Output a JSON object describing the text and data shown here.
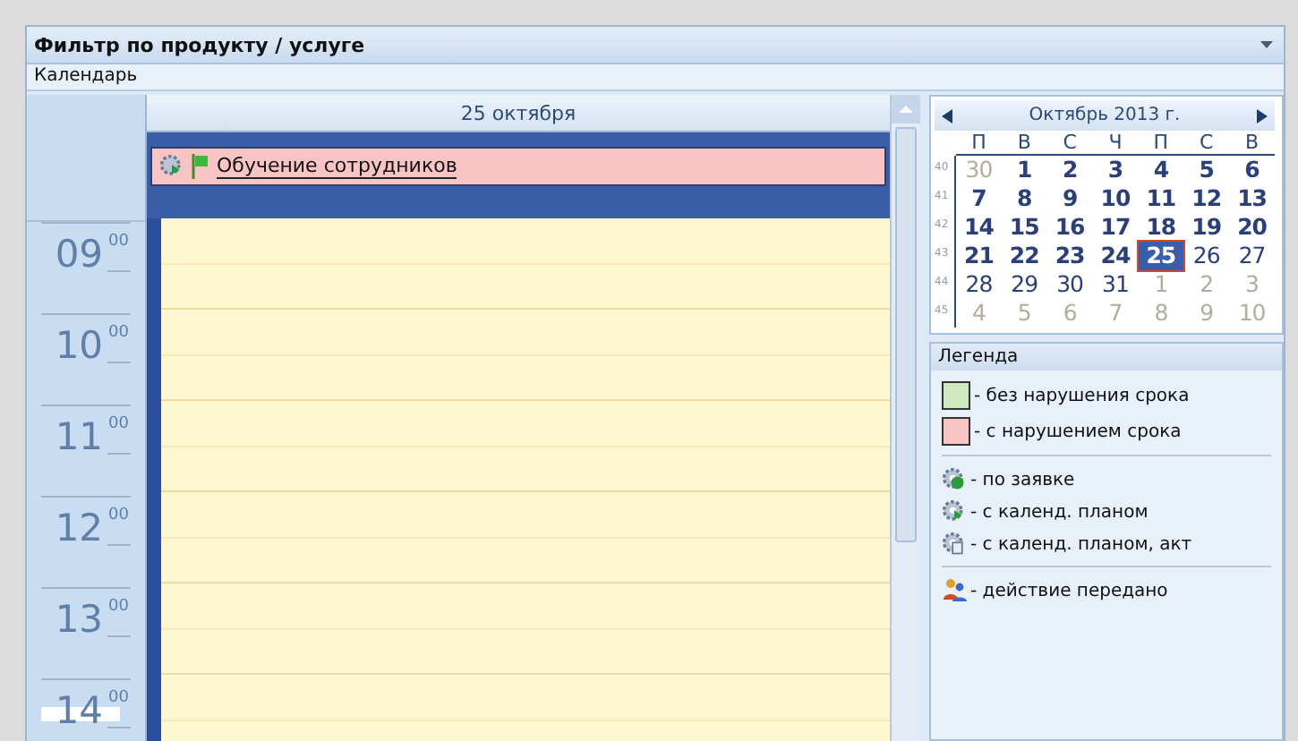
{
  "filter_bar": {
    "title": "Фильтр по продукту / услуге"
  },
  "section_label": "Календарь",
  "day_view": {
    "day_header": "25 октября",
    "events": [
      {
        "title": "Обучение сотрудников",
        "color": "#f8c4c4"
      }
    ],
    "hours": [
      {
        "hour": "09",
        "minutes": "00",
        "current": false
      },
      {
        "hour": "10",
        "minutes": "00",
        "current": false
      },
      {
        "hour": "11",
        "minutes": "00",
        "current": false
      },
      {
        "hour": "12",
        "minutes": "00",
        "current": false
      },
      {
        "hour": "13",
        "minutes": "00",
        "current": false
      },
      {
        "hour": "14",
        "minutes": "00",
        "current": true
      }
    ]
  },
  "mini_calendar": {
    "month_title": "Октябрь 2013 г.",
    "weekdays": [
      "П",
      "В",
      "С",
      "Ч",
      "П",
      "С",
      "В"
    ],
    "weeks": [
      {
        "number": "40",
        "days": [
          {
            "label": "30",
            "in_month": false,
            "bold": false,
            "selected": false
          },
          {
            "label": "1",
            "in_month": true,
            "bold": true,
            "selected": false
          },
          {
            "label": "2",
            "in_month": true,
            "bold": true,
            "selected": false
          },
          {
            "label": "3",
            "in_month": true,
            "bold": true,
            "selected": false
          },
          {
            "label": "4",
            "in_month": true,
            "bold": true,
            "selected": false
          },
          {
            "label": "5",
            "in_month": true,
            "bold": true,
            "selected": false
          },
          {
            "label": "6",
            "in_month": true,
            "bold": true,
            "selected": false
          }
        ]
      },
      {
        "number": "41",
        "days": [
          {
            "label": "7",
            "in_month": true,
            "bold": true,
            "selected": false
          },
          {
            "label": "8",
            "in_month": true,
            "bold": true,
            "selected": false
          },
          {
            "label": "9",
            "in_month": true,
            "bold": true,
            "selected": false
          },
          {
            "label": "10",
            "in_month": true,
            "bold": true,
            "selected": false
          },
          {
            "label": "11",
            "in_month": true,
            "bold": true,
            "selected": false
          },
          {
            "label": "12",
            "in_month": true,
            "bold": true,
            "selected": false
          },
          {
            "label": "13",
            "in_month": true,
            "bold": true,
            "selected": false
          }
        ]
      },
      {
        "number": "42",
        "days": [
          {
            "label": "14",
            "in_month": true,
            "bold": true,
            "selected": false
          },
          {
            "label": "15",
            "in_month": true,
            "bold": true,
            "selected": false
          },
          {
            "label": "16",
            "in_month": true,
            "bold": true,
            "selected": false
          },
          {
            "label": "17",
            "in_month": true,
            "bold": true,
            "selected": false
          },
          {
            "label": "18",
            "in_month": true,
            "bold": true,
            "selected": false
          },
          {
            "label": "19",
            "in_month": true,
            "bold": true,
            "selected": false
          },
          {
            "label": "20",
            "in_month": true,
            "bold": true,
            "selected": false
          }
        ]
      },
      {
        "number": "43",
        "days": [
          {
            "label": "21",
            "in_month": true,
            "bold": true,
            "selected": false
          },
          {
            "label": "22",
            "in_month": true,
            "bold": true,
            "selected": false
          },
          {
            "label": "23",
            "in_month": true,
            "bold": true,
            "selected": false
          },
          {
            "label": "24",
            "in_month": true,
            "bold": true,
            "selected": false
          },
          {
            "label": "25",
            "in_month": true,
            "bold": true,
            "selected": true
          },
          {
            "label": "26",
            "in_month": true,
            "bold": false,
            "selected": false
          },
          {
            "label": "27",
            "in_month": true,
            "bold": false,
            "selected": false
          }
        ]
      },
      {
        "number": "44",
        "days": [
          {
            "label": "28",
            "in_month": true,
            "bold": false,
            "selected": false
          },
          {
            "label": "29",
            "in_month": true,
            "bold": false,
            "selected": false
          },
          {
            "label": "30",
            "in_month": true,
            "bold": false,
            "selected": false
          },
          {
            "label": "31",
            "in_month": true,
            "bold": false,
            "selected": false
          },
          {
            "label": "1",
            "in_month": false,
            "bold": false,
            "selected": false
          },
          {
            "label": "2",
            "in_month": false,
            "bold": false,
            "selected": false
          },
          {
            "label": "3",
            "in_month": false,
            "bold": false,
            "selected": false
          }
        ]
      },
      {
        "number": "45",
        "days": [
          {
            "label": "4",
            "in_month": false,
            "bold": false,
            "selected": false
          },
          {
            "label": "5",
            "in_month": false,
            "bold": false,
            "selected": false
          },
          {
            "label": "6",
            "in_month": false,
            "bold": false,
            "selected": false
          },
          {
            "label": "7",
            "in_month": false,
            "bold": false,
            "selected": false
          },
          {
            "label": "8",
            "in_month": false,
            "bold": false,
            "selected": false
          },
          {
            "label": "9",
            "in_month": false,
            "bold": false,
            "selected": false
          },
          {
            "label": "10",
            "in_month": false,
            "bold": false,
            "selected": false
          }
        ]
      }
    ]
  },
  "legend": {
    "title": "Легенда",
    "groups": [
      [
        {
          "kind": "swatch",
          "color": "#cfe8c0",
          "label": "- без нарушения срока"
        },
        {
          "kind": "swatch",
          "color": "#f8c4c4",
          "label": "- с нарушением срока"
        }
      ],
      [
        {
          "kind": "gear-check",
          "label": "- по заявке"
        },
        {
          "kind": "gear-play",
          "label": "- с календ. планом"
        },
        {
          "kind": "gear-doc",
          "label": "- с календ. планом, акт"
        }
      ],
      [
        {
          "kind": "handover",
          "label": "- действие передано"
        }
      ]
    ]
  }
}
